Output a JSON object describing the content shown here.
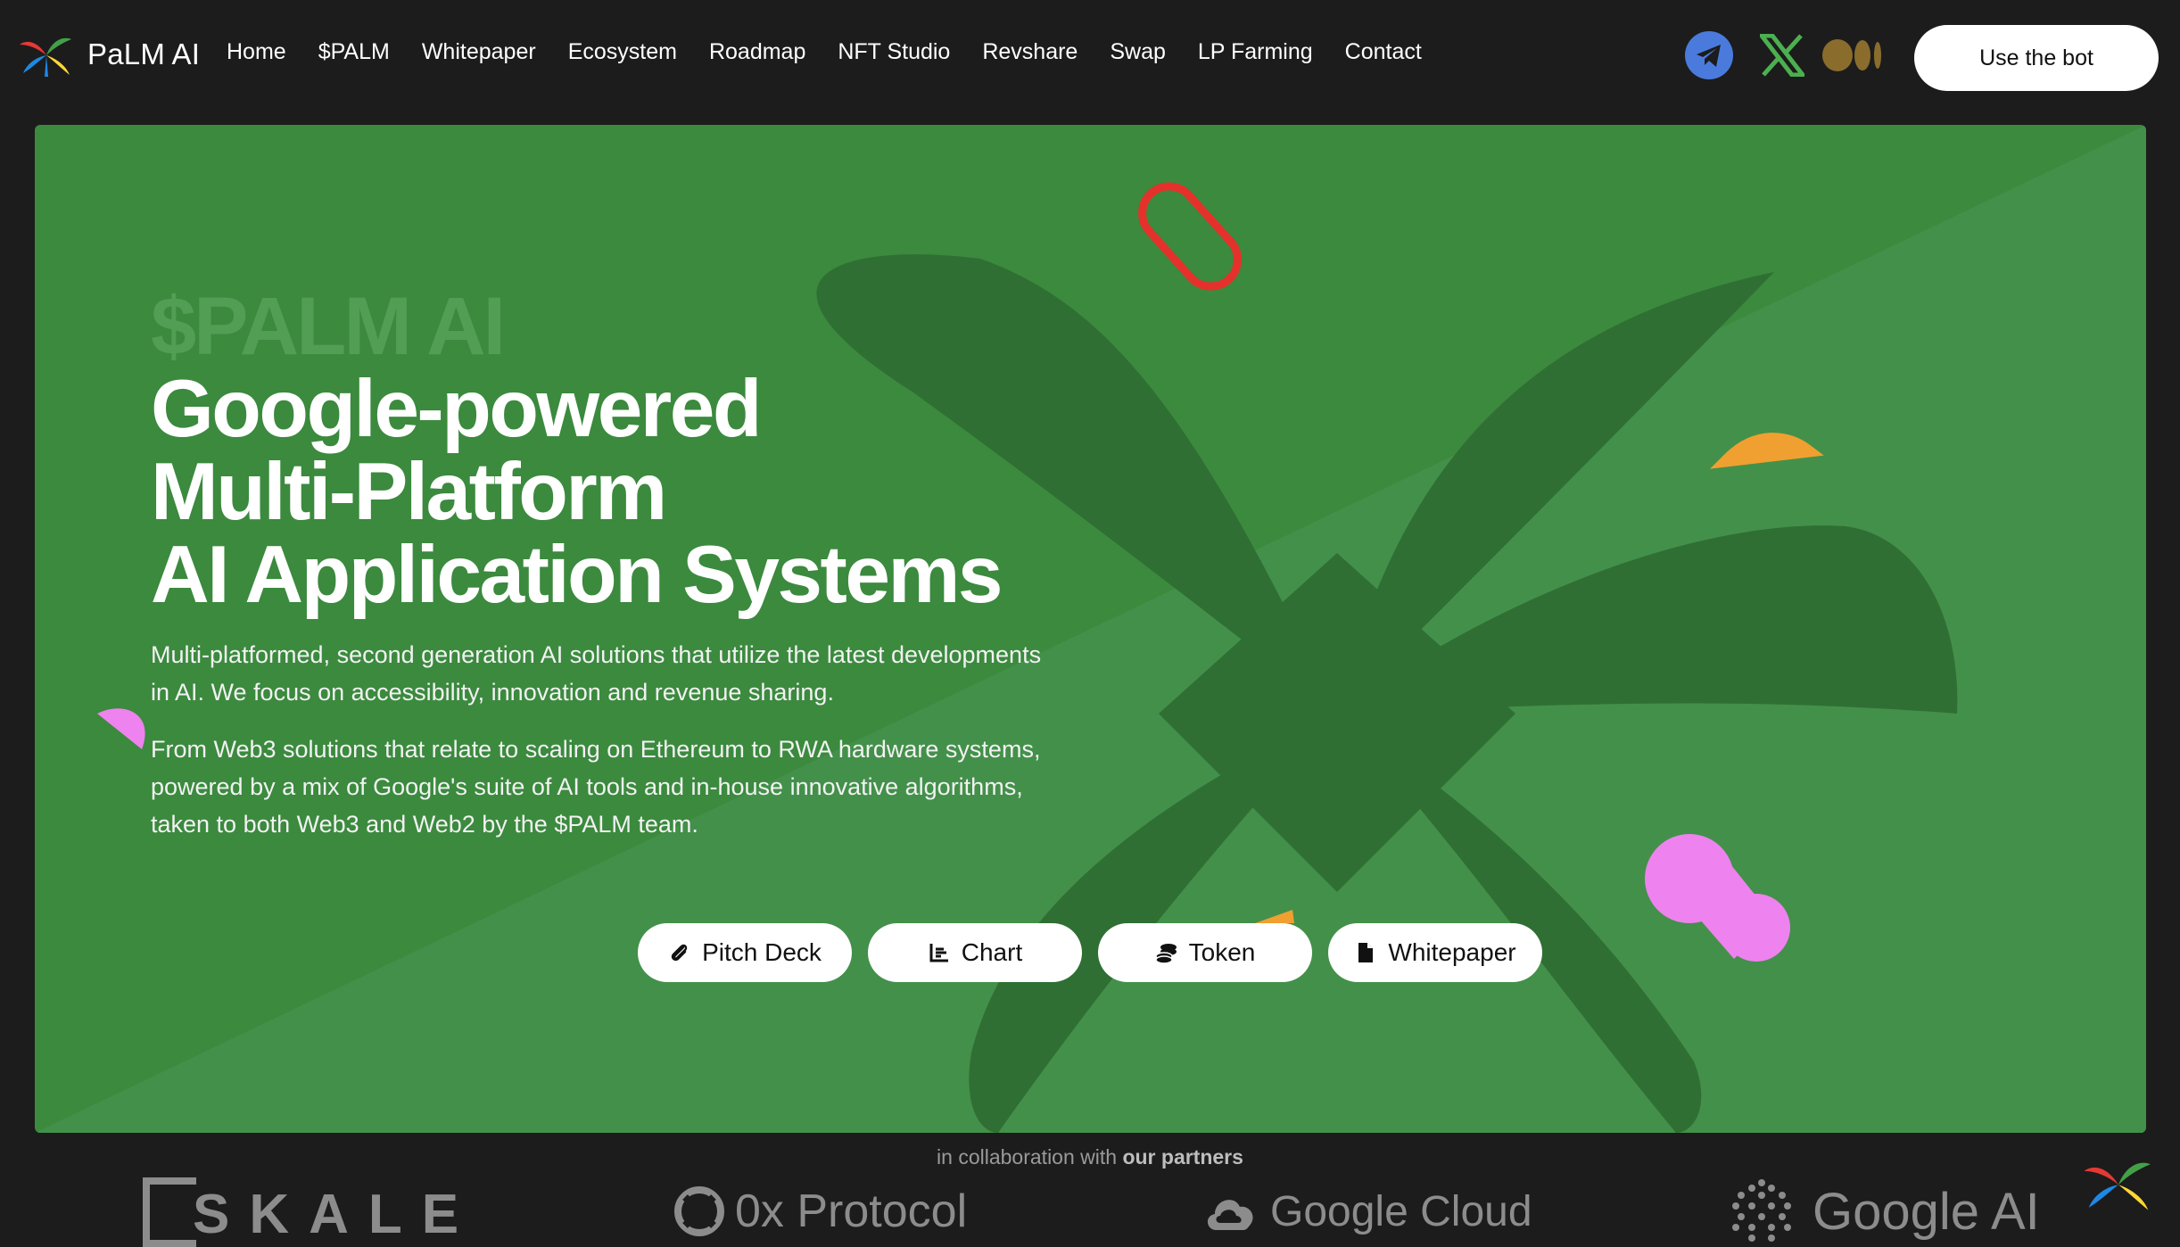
{
  "brand": {
    "name": "PaLM AI",
    "logo_icon": "palm-tree-icon"
  },
  "nav": {
    "links": [
      "Home",
      "$PALM",
      "Whitepaper",
      "Ecosystem",
      "Roadmap",
      "NFT Studio",
      "Revshare",
      "Swap",
      "LP Farming",
      "Contact"
    ],
    "socials": [
      "telegram-icon",
      "x-icon",
      "medium-icon"
    ],
    "cta_label": "Use the bot"
  },
  "hero": {
    "kicker": "$PALM AI",
    "title_lines": [
      "Google-powered",
      "Multi-Platform",
      "AI Application Systems"
    ],
    "paragraph1": "Multi-platformed, second generation AI solutions that utilize the latest developments in AI. We focus on accessibility, innovation and revenue sharing.",
    "paragraph2": "From Web3 solutions that relate to scaling on Ethereum to RWA hardware systems, powered by a mix of Google's suite of AI tools and in-house innovative algorithms, taken to both Web3 and Web2 by the $PALM team.",
    "buttons": [
      {
        "label": "Pitch Deck",
        "icon": "paperclip-icon"
      },
      {
        "label": "Chart",
        "icon": "chart-icon"
      },
      {
        "label": "Token",
        "icon": "coins-icon"
      },
      {
        "label": "Whitepaper",
        "icon": "document-icon"
      }
    ]
  },
  "partners": {
    "caption_prefix": "in collaboration with",
    "caption_bold": "our partners",
    "logos": [
      "SKALE",
      "0x Protocol",
      "Google Cloud",
      "Google AI"
    ]
  },
  "colors": {
    "page_bg": "#1c1c1c",
    "hero_bg": "#3b8a3e",
    "palm_shape": "#306f33",
    "accent_red": "#e5312b",
    "accent_pink": "#ee82ee",
    "accent_orange": "#f0a030",
    "telegram_blue": "#4a7bdc",
    "x_green": "#4caf50",
    "medium_gold": "#8a6d2c"
  }
}
